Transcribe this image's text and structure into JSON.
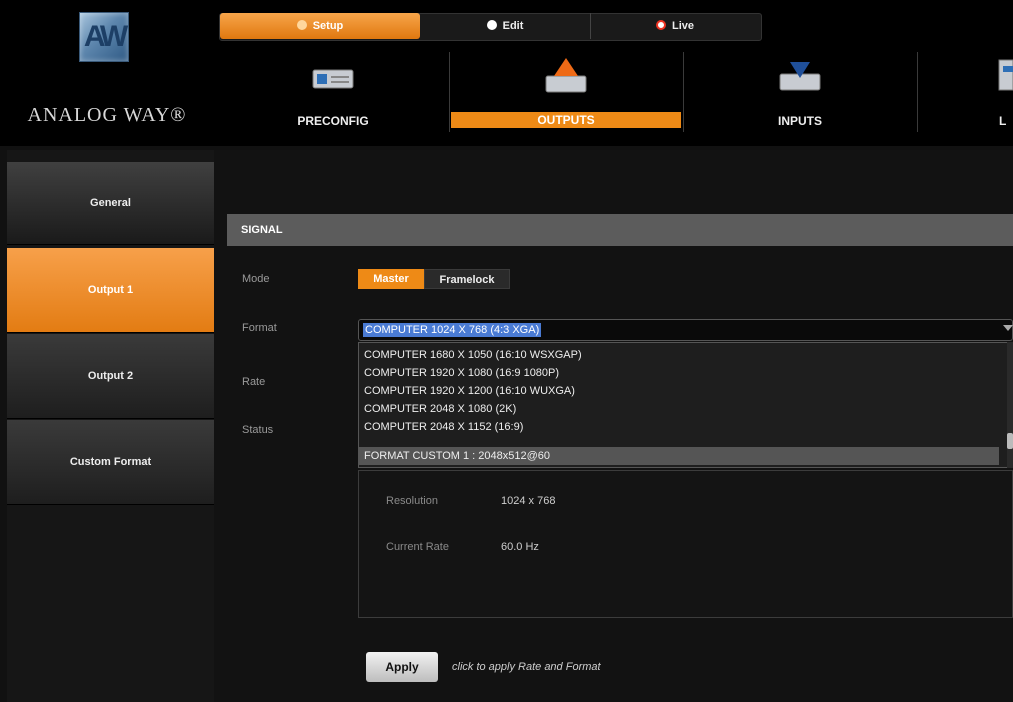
{
  "brand": {
    "logo_text": "ANALOG WAY®",
    "accent": "#ee8a16"
  },
  "mode_tabs": [
    {
      "label": "Setup",
      "icon": "gear-icon",
      "active": true
    },
    {
      "label": "Edit",
      "icon": "play-icon",
      "active": false
    },
    {
      "label": "Live",
      "icon": "record-icon",
      "active": false
    }
  ],
  "nav": [
    {
      "label": "PRECONFIG",
      "icon": "device-icon",
      "active": false
    },
    {
      "label": "OUTPUTS",
      "icon": "outputs-icon",
      "active": true
    },
    {
      "label": "INPUTS",
      "icon": "inputs-icon",
      "active": false
    },
    {
      "label": "L",
      "icon": "layers-icon",
      "active": false
    }
  ],
  "sidebar": {
    "items": [
      {
        "label": "General",
        "active": false
      },
      {
        "label": "Output 1",
        "active": true
      },
      {
        "label": "Output 2",
        "active": false
      },
      {
        "label": "Custom Format",
        "active": false
      }
    ]
  },
  "signal": {
    "header": "SIGNAL",
    "labels": {
      "mode": "Mode",
      "format": "Format",
      "rate": "Rate",
      "status": "Status"
    },
    "mode_options": [
      "Master",
      "Framelock"
    ],
    "mode_selected": "Master",
    "format_selected": "COMPUTER 1024 X 768  (4:3 XGA)",
    "format_options": [
      "COMPUTER 1680 X 1050 (16:10 WSXGAP)",
      "COMPUTER 1920 X 1080 (16:9 1080P)",
      "COMPUTER 1920 X 1200 (16:10 WUXGA)",
      "COMPUTER 2048 X 1080 (2K)",
      "COMPUTER 2048 X 1152 (16:9)",
      "FORMAT CUSTOM 1 : 2048x512@60"
    ],
    "format_highlighted": "FORMAT CUSTOM 1 : 2048x512@60"
  },
  "status": {
    "resolution_label": "Resolution",
    "resolution_value": "1024 x 768",
    "rate_label": "Current Rate",
    "rate_value": "60.0 Hz"
  },
  "apply": {
    "label": "Apply",
    "hint": "click to apply Rate and Format"
  }
}
